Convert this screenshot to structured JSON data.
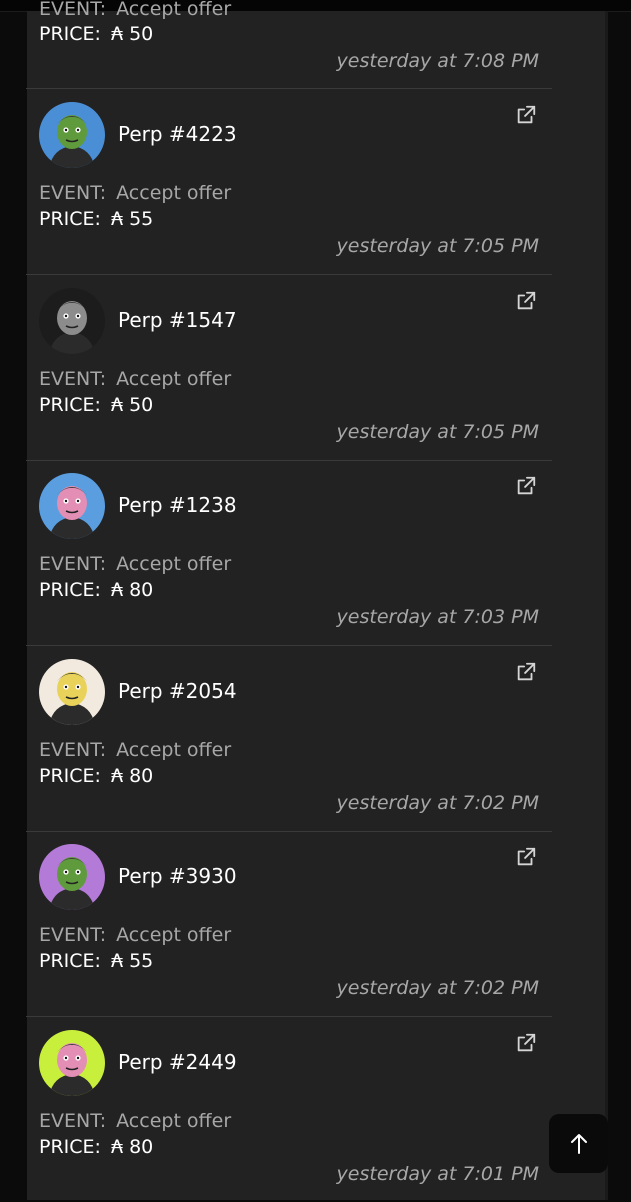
{
  "top_partial": {
    "event_label": "EVENT:",
    "event_value": "Accept offer",
    "price_label": "PRICE:",
    "price_value": "₳ 50",
    "time": "yesterday at 7:08 PM"
  },
  "items": [
    {
      "name": "Perp #4223",
      "event_label": "EVENT:",
      "event_value": "Accept offer",
      "price_label": "PRICE:",
      "price_value": "₳ 55",
      "time": "yesterday at 7:05 PM",
      "bg": "#4a8fd6",
      "skin": "#5f9b3c"
    },
    {
      "name": "Perp #1547",
      "event_label": "EVENT:",
      "event_value": "Accept offer",
      "price_label": "PRICE:",
      "price_value": "₳ 50",
      "time": "yesterday at 7:05 PM",
      "bg": "#1c1c1c",
      "skin": "#8c8c8c"
    },
    {
      "name": "Perp #1238",
      "event_label": "EVENT:",
      "event_value": "Accept offer",
      "price_label": "PRICE:",
      "price_value": "₳ 80",
      "time": "yesterday at 7:03 PM",
      "bg": "#5a9ee0",
      "skin": "#e38fb5"
    },
    {
      "name": "Perp #2054",
      "event_label": "EVENT:",
      "event_value": "Accept offer",
      "price_label": "PRICE:",
      "price_value": "₳ 80",
      "time": "yesterday at 7:02 PM",
      "bg": "#f2eadf",
      "skin": "#e9d25a"
    },
    {
      "name": "Perp #3930",
      "event_label": "EVENT:",
      "event_value": "Accept offer",
      "price_label": "PRICE:",
      "price_value": "₳ 55",
      "time": "yesterday at 7:02 PM",
      "bg": "#b47ad8",
      "skin": "#5f9b3c"
    },
    {
      "name": "Perp #2449",
      "event_label": "EVENT:",
      "event_value": "Accept offer",
      "price_label": "PRICE:",
      "price_value": "₳ 80",
      "time": "yesterday at 7:01 PM",
      "bg": "#c9ef3d",
      "skin": "#e38fb5"
    }
  ],
  "icons": {
    "external_link": "external-link-icon",
    "scroll_top": "arrow-up-icon"
  }
}
